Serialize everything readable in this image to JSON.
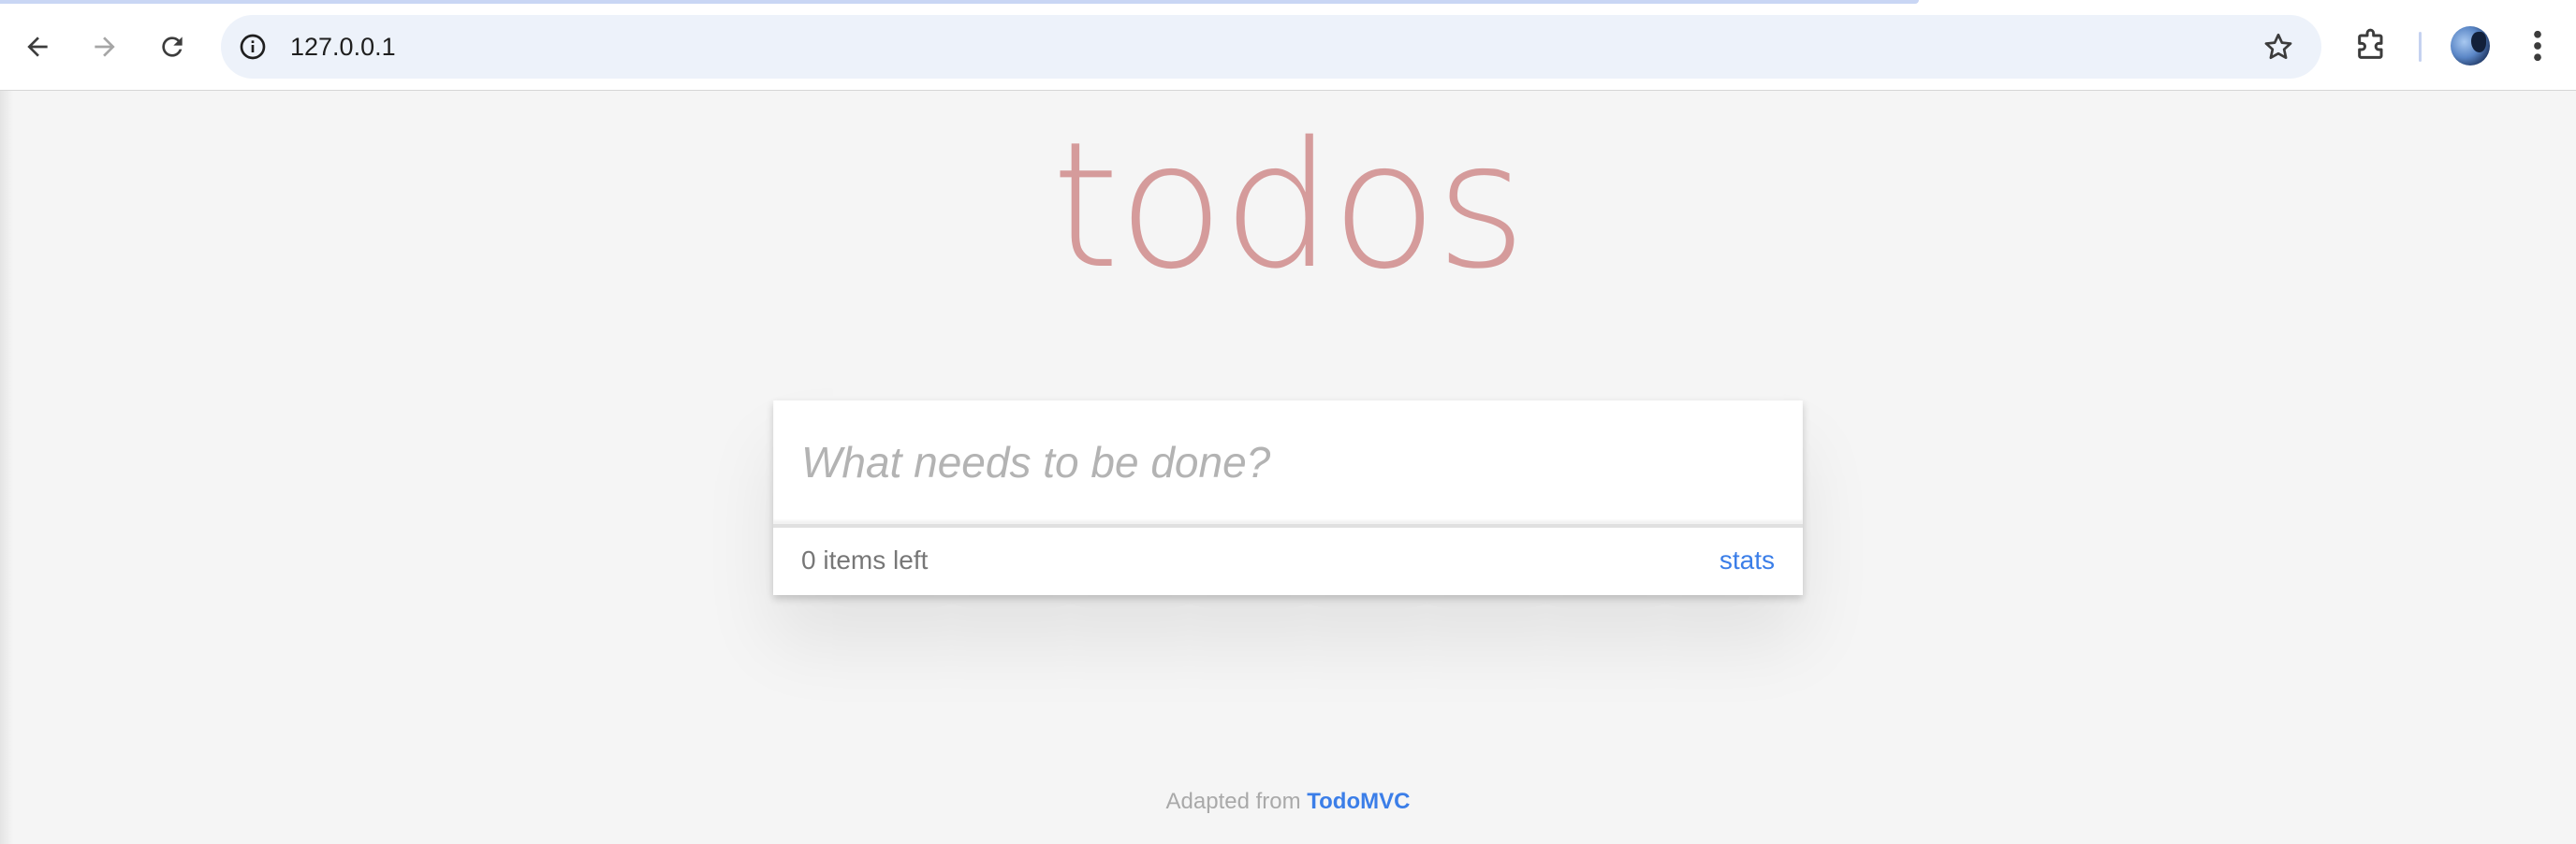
{
  "browser": {
    "url": "127.0.0.1",
    "icons": {
      "back": "arrow-left-icon",
      "forward": "arrow-right-icon",
      "reload": "reload-icon",
      "site_info": "info-icon",
      "bookmark": "star-icon",
      "extensions": "puzzle-icon",
      "profile": "avatar",
      "menu": "kebab-menu-icon"
    }
  },
  "app": {
    "title": "todos",
    "new_todo_placeholder": "What needs to be done?",
    "new_todo_value": "",
    "items_left": "0 items left",
    "stats_link": "stats"
  },
  "footer": {
    "prefix": "Adapted from ",
    "link_text": "TodoMVC"
  },
  "colors": {
    "title": "#d5a0a0",
    "link": "#3b7ee8",
    "background": "#f5f5f5"
  }
}
